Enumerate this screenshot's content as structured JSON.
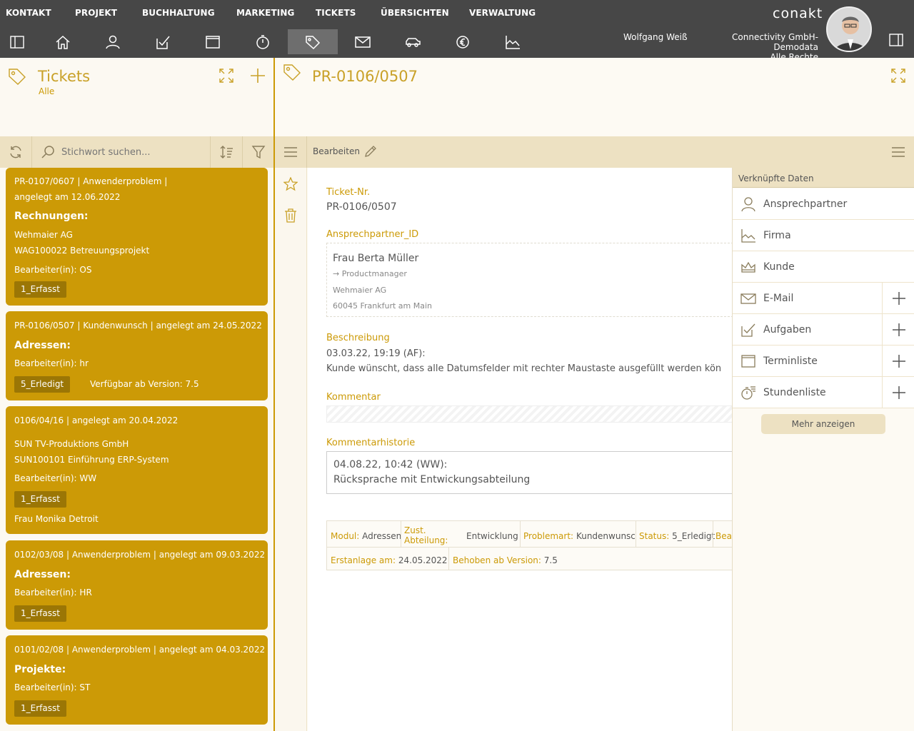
{
  "menu": [
    "KONTAKT",
    "PROJEKT",
    "BUCHHALTUNG",
    "MARKETING",
    "TICKETS",
    "ÜBERSICHTEN",
    "VERWALTUNG"
  ],
  "app": {
    "logo": "conakt",
    "user": "Wolfgang Weiß",
    "company": "Connectivity GmbH-Demodata",
    "rights": "Alle Rechte"
  },
  "left": {
    "title": "Tickets",
    "subtitle": "Alle",
    "search_placeholder": "Stichwort suchen..."
  },
  "cards": [
    {
      "line1": "PR-0107/0607 | Anwenderproblem |",
      "line2": "angelegt am 12.06.2022",
      "heading": "Rechnungen:",
      "lines": [
        "Wehmaier AG",
        "WAG100022 Betreuungsprojekt"
      ],
      "worker": "Bearbeiter(in): OS",
      "badge": "1_Erfasst"
    },
    {
      "line1": "PR-0106/0507 | Kundenwunsch | angelegt am 24.05.2022",
      "heading": "Adressen:",
      "worker": "Bearbeiter(in): hr",
      "badge": "5_Erledigt",
      "extra": "Verfügbar ab Version: 7.5"
    },
    {
      "line1": "0106/04/16 |  angelegt am 20.04.2022",
      "lines": [
        "SUN TV-Produktions GmbH",
        "SUN100101 Einführung ERP-System"
      ],
      "worker": "Bearbeiter(in): WW",
      "badge": "1_Erfasst",
      "footer": "Frau Monika Detroit"
    },
    {
      "line1": "0102/03/08 | Anwenderproblem | angelegt am 09.03.2022",
      "heading": "Adressen:",
      "worker": "Bearbeiter(in): HR",
      "badge": "1_Erfasst"
    },
    {
      "line1": "0101/02/08 | Anwenderproblem | angelegt am 04.03.2022",
      "heading": "Projekte:",
      "worker": "Bearbeiter(in): ST",
      "badge": "1_Erfasst"
    }
  ],
  "detail": {
    "title": "PR-0106/0507",
    "edit_label": "Bearbeiten",
    "ticket_label": "Ticket-Nr.",
    "ticket_value": "PR-0106/0507",
    "contact_label": "Ansprechpartner_ID",
    "contact": {
      "name": "Frau Berta Müller",
      "role": "→ Productmanager",
      "company": "Wehmaier AG",
      "city": "60045 Frankfurt am Main"
    },
    "desc_label": "Beschreibung",
    "desc_line1": "03.03.22, 19:19 (AF):",
    "desc_line2": "Kunde wünscht, dass alle Datumsfelder mit rechter Maustaste ausgefüllt werden kön",
    "comment_label": "Kommentar",
    "history_label": "Kommentarhistorie",
    "history_line1": "04.08.22, 10:42 (WW):",
    "history_line2": "Rücksprache mit Entwickungsabteilung",
    "info": {
      "modul_k": "Modul:",
      "modul_v": "Adressen",
      "zust_k1": "Zust.",
      "zust_k2": "Abteilung:",
      "zust_v": "Entwicklung",
      "problem_k": "Problemart:",
      "problem_v": "Kundenwunsch",
      "status_k": "Status:",
      "status_v": "5_Erledigt",
      "bear_k": "Bear",
      "erst_k": "Erstanlage am:",
      "erst_v": "24.05.2022",
      "behoben_k": "Behoben ab Version:",
      "behoben_v": "7.5"
    }
  },
  "linked": {
    "header": "Verknüpfte Daten",
    "items": [
      "Ansprechpartner",
      "Firma",
      "Kunde",
      "E-Mail",
      "Aufgaben",
      "Terminliste",
      "Stundenliste"
    ],
    "more": "Mehr anzeigen"
  },
  "colors": {
    "accent": "#cc9a06",
    "topbar": "#474747",
    "panel": "#ede1c2"
  }
}
